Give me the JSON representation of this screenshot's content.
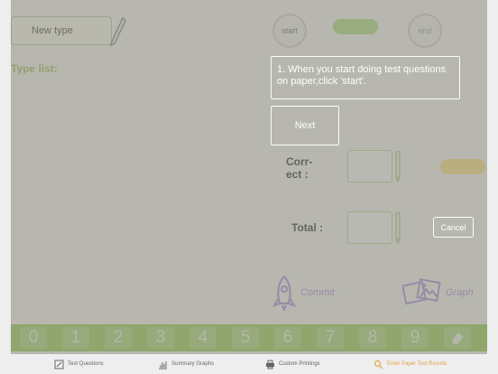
{
  "header": {
    "new_type_placeholder": "New type",
    "type_list_label": "Type list:",
    "start_label": "start",
    "end_label": "end"
  },
  "tutorial": {
    "message": "1. When you start doing test questions on paper,click 'start'.",
    "next_label": "Next"
  },
  "form": {
    "correct_label": "Corr-ect :",
    "total_label": "Total :",
    "cancel_label": "Cancel"
  },
  "actions": {
    "commit_label": "Commit",
    "graph_label": "Graph"
  },
  "keypad": {
    "digits": [
      "0",
      "1",
      "2",
      "3",
      "4",
      "5",
      "6",
      "7",
      "8",
      "9"
    ]
  },
  "tabs": [
    {
      "label": "Test Questions",
      "icon": "edit-icon"
    },
    {
      "label": "Summary Graphs",
      "icon": "chart-icon"
    },
    {
      "label": "Custom Printings",
      "icon": "printer-icon"
    },
    {
      "label": "Enter Paper Test Results",
      "icon": "search-icon"
    }
  ],
  "colors": {
    "accent_green": "#a3d560",
    "active_tab": "#e6a14a",
    "commit_purple": "#b09ae0"
  }
}
